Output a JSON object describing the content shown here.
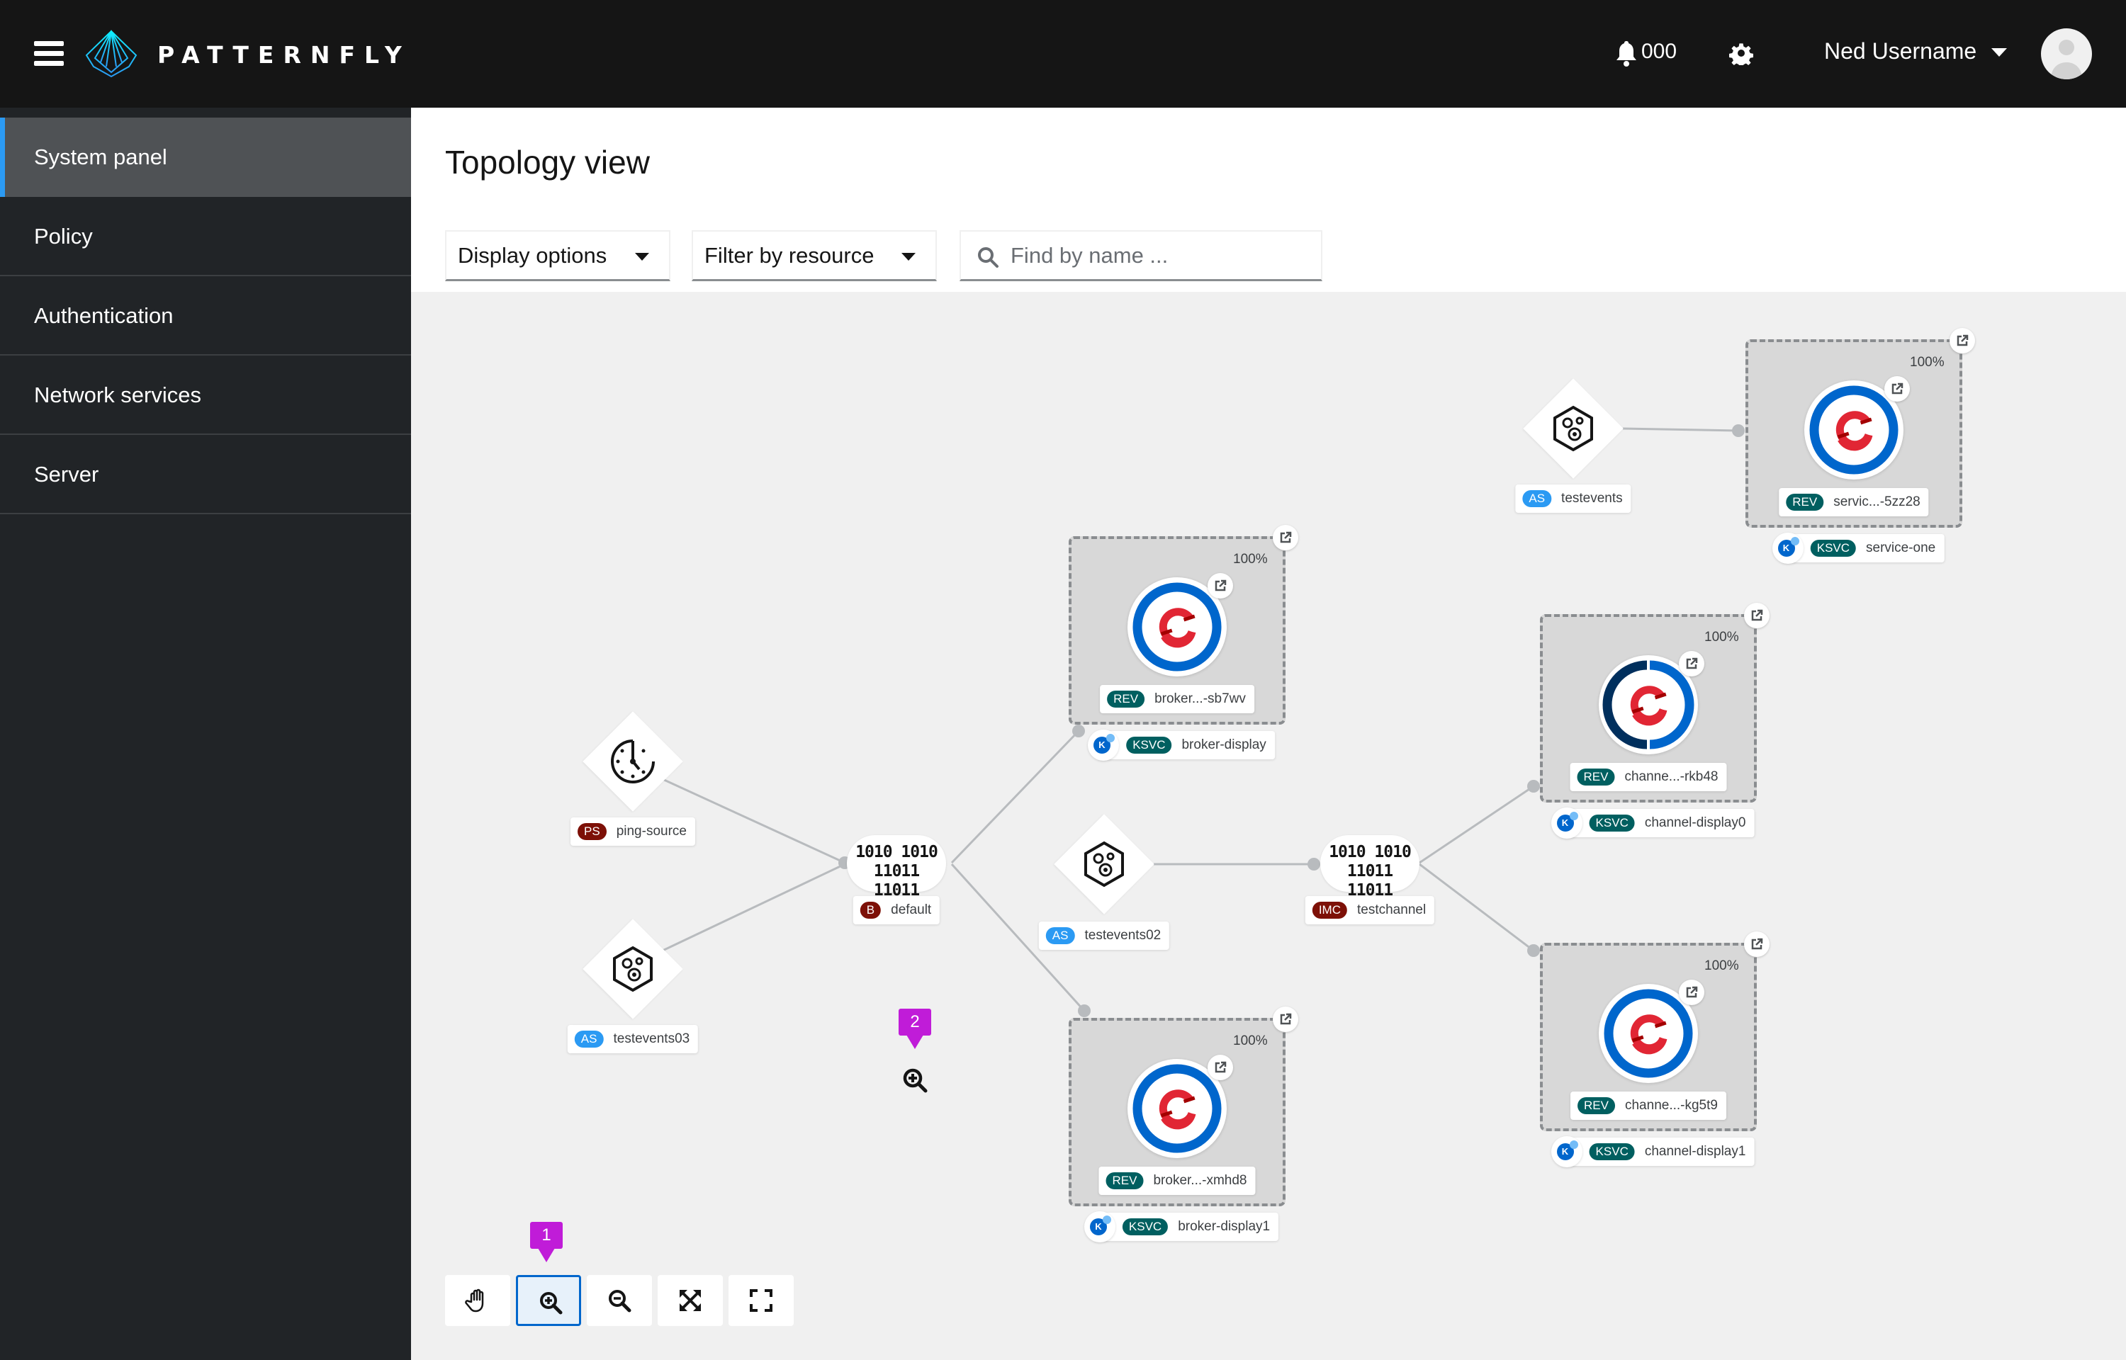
{
  "header": {
    "brand": "PATTERNFLY",
    "notification_count": "000",
    "user_name": "Ned Username"
  },
  "sidebar": {
    "items": [
      {
        "label": "System panel",
        "active": true
      },
      {
        "label": "Policy",
        "active": false
      },
      {
        "label": "Authentication",
        "active": false
      },
      {
        "label": "Network services",
        "active": false
      },
      {
        "label": "Server",
        "active": false
      }
    ]
  },
  "page": {
    "title": "Topology view",
    "display_options_label": "Display options",
    "filter_label": "Filter by resource",
    "search_placeholder": "Find by name ..."
  },
  "colors": {
    "accent_blue": "#0066cc",
    "nav_active_bar": "#2b9af3",
    "badge_red": "#7d1007",
    "badge_blue": "#2b9af3",
    "badge_teal": "#005f60",
    "marker_purple": "#c01cd8",
    "openshift_red": "#e12634",
    "ring_dark": "#002f5d"
  },
  "topology": {
    "sources": [
      {
        "id": "ping-source",
        "badge": "PS",
        "badge_color": "#7d1007",
        "name": "ping-source",
        "icon": "clock-icon"
      },
      {
        "id": "testevents03",
        "badge": "AS",
        "badge_color": "#2b9af3",
        "name": "testevents03",
        "icon": "gears-icon"
      },
      {
        "id": "testevents02",
        "badge": "AS",
        "badge_color": "#2b9af3",
        "name": "testevents02",
        "icon": "gears-icon"
      },
      {
        "id": "testevents",
        "badge": "AS",
        "badge_color": "#2b9af3",
        "name": "testevents",
        "icon": "gears-icon"
      }
    ],
    "brokers": [
      {
        "id": "default",
        "badge": "B",
        "name": "default",
        "icon_text": [
          "1010 1010",
          "11011 11011"
        ]
      },
      {
        "id": "testchannel",
        "badge": "IMC",
        "name": "testchannel",
        "icon_text": [
          "1010 1010",
          "11011 11011"
        ]
      }
    ],
    "services": [
      {
        "id": "broker-display",
        "rev_badge": "REV",
        "rev_name": "broker...-sb7wv",
        "ksvc_badge": "KSVC",
        "ksvc_name": "broker-display",
        "traffic": "100%",
        "ring": "full"
      },
      {
        "id": "broker-display1",
        "rev_badge": "REV",
        "rev_name": "broker...-xmhd8",
        "ksvc_badge": "KSVC",
        "ksvc_name": "broker-display1",
        "traffic": "100%",
        "ring": "full"
      },
      {
        "id": "channel-display0",
        "rev_badge": "REV",
        "rev_name": "channe...-rkb48",
        "ksvc_badge": "KSVC",
        "ksvc_name": "channel-display0",
        "traffic": "100%",
        "ring": "split"
      },
      {
        "id": "channel-display1",
        "rev_badge": "REV",
        "rev_name": "channe...-kg5t9",
        "ksvc_badge": "KSVC",
        "ksvc_name": "channel-display1",
        "traffic": "100%",
        "ring": "full"
      },
      {
        "id": "service-one",
        "rev_badge": "REV",
        "rev_name": "servic...-5zz28",
        "ksvc_badge": "KSVC",
        "ksvc_name": "service-one",
        "traffic": "100%",
        "ring": "full"
      }
    ],
    "edges": [
      {
        "from": "ping-source",
        "to": "default"
      },
      {
        "from": "testevents03",
        "to": "default"
      },
      {
        "from": "default",
        "to": "broker-display"
      },
      {
        "from": "default",
        "to": "broker-display1"
      },
      {
        "from": "testevents02",
        "to": "testchannel"
      },
      {
        "from": "testchannel",
        "to": "channel-display0"
      },
      {
        "from": "testchannel",
        "to": "channel-display1"
      },
      {
        "from": "testevents",
        "to": "service-one"
      }
    ]
  },
  "markers": [
    {
      "number": "1",
      "target": "zoom-in-button"
    },
    {
      "number": "2",
      "target": "canvas-zoom-cursor"
    }
  ],
  "controls": [
    {
      "id": "pan",
      "icon": "hand-icon",
      "active": false
    },
    {
      "id": "zoom-in",
      "icon": "zoom-in-icon",
      "active": true
    },
    {
      "id": "zoom-out",
      "icon": "zoom-out-icon",
      "active": false
    },
    {
      "id": "fit-to-screen",
      "icon": "expand-arrows-icon",
      "active": false
    },
    {
      "id": "reset-view",
      "icon": "fullscreen-icon",
      "active": false
    }
  ]
}
